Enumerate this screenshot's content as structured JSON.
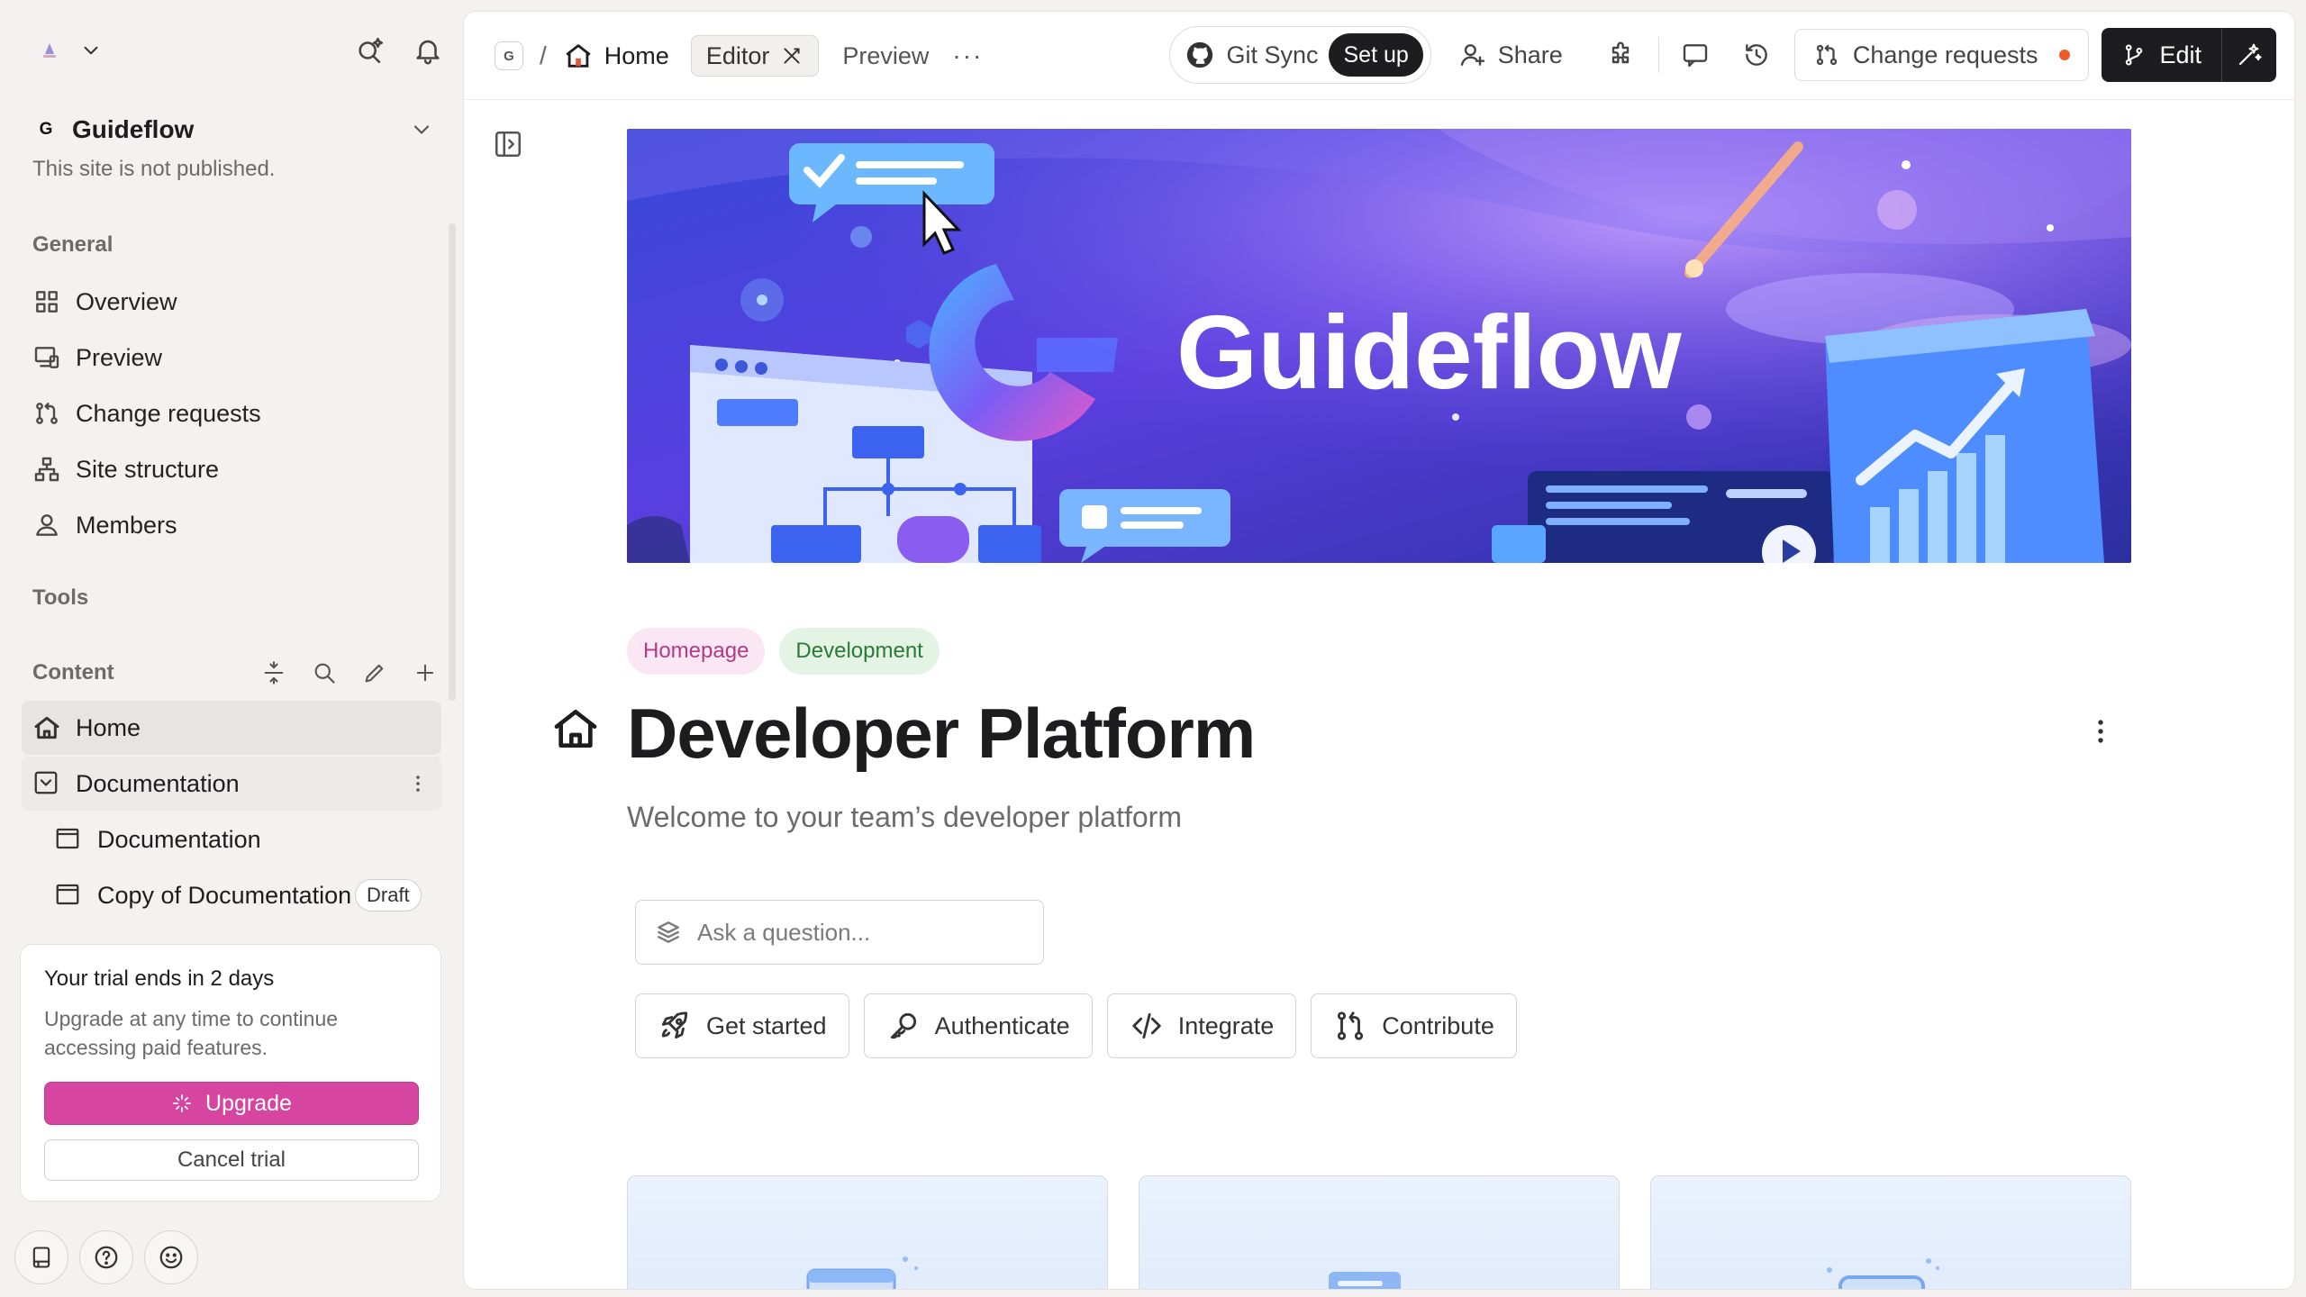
{
  "sidebar": {
    "site": {
      "logo_letter": "G",
      "name": "Guideflow",
      "status": "This site is not published."
    },
    "general_label": "General",
    "nav": [
      {
        "label": "Overview",
        "icon": "grid-icon"
      },
      {
        "label": "Preview",
        "icon": "monitor-icon"
      },
      {
        "label": "Change requests",
        "icon": "branch-icon"
      },
      {
        "label": "Site structure",
        "icon": "sitemap-icon"
      },
      {
        "label": "Members",
        "icon": "users-icon"
      }
    ],
    "tools_label": "Tools",
    "content_label": "Content",
    "tree": {
      "home": "Home",
      "documentation_group": "Documentation",
      "documentation_page": "Documentation",
      "copy_page": "Copy of Documentation",
      "draft_badge": "Draft"
    },
    "trial": {
      "title": "Your trial ends in 2 days",
      "text": "Upgrade at any time to continue accessing paid features.",
      "upgrade": "Upgrade",
      "cancel": "Cancel trial"
    }
  },
  "topbar": {
    "space_letter": "G",
    "separator": "/",
    "breadcrumb_home": "Home",
    "editor_tab": "Editor",
    "preview_tab": "Preview",
    "more": "···",
    "git_sync": "Git Sync",
    "setup": "Set up",
    "share": "Share",
    "change_requests": "Change requests",
    "edit": "Edit"
  },
  "page": {
    "cover_text": "Guideflow",
    "tags": [
      "Homepage",
      "Development"
    ],
    "title": "Developer Platform",
    "subtitle": "Welcome to your team’s developer platform",
    "ask_placeholder": "Ask a question...",
    "quick_buttons": [
      "Get started",
      "Authenticate",
      "Integrate",
      "Contribute"
    ]
  },
  "colors": {
    "accent_pink": "#d6459f",
    "notification_dot": "#f05a28",
    "tag_pink_bg": "#fbe6f3",
    "tag_green_bg": "#e3f4e4"
  }
}
